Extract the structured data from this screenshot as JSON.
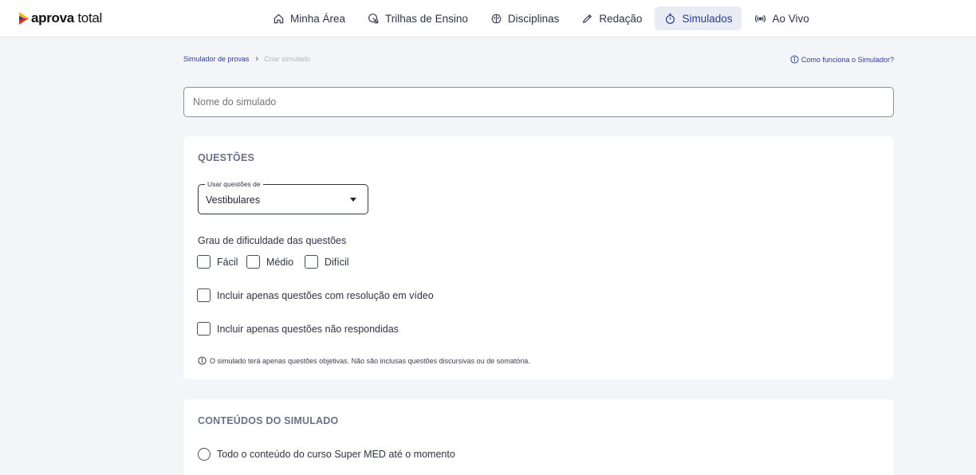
{
  "brand": {
    "name_bold": "aprova",
    "name_regular": " total"
  },
  "nav": {
    "items": [
      {
        "label": "Minha Área",
        "icon": "home-icon"
      },
      {
        "label": "Trilhas de Ensino",
        "icon": "trail-icon"
      },
      {
        "label": "Disciplinas",
        "icon": "brain-icon"
      },
      {
        "label": "Redação",
        "icon": "pencil-icon"
      },
      {
        "label": "Simulados",
        "icon": "stopwatch-icon",
        "active": true
      },
      {
        "label": "Ao Vivo",
        "icon": "broadcast-icon"
      }
    ]
  },
  "breadcrumb": {
    "parent": "Simulador de provas",
    "current": "Criar simulado"
  },
  "help_link": "Como funciona o Simulador?",
  "name_input": {
    "placeholder": "Nome do simulado"
  },
  "questoes": {
    "title": "QUESTÕES",
    "source_select": {
      "legend": "Usar questões de",
      "value": "Vestibulares"
    },
    "difficulty_label": "Grau de dificuldade das questões",
    "difficulty_options": [
      "Fácil",
      "Médio",
      "Difícil"
    ],
    "video_only": "Incluir apenas questões com resolução em vídeo",
    "unanswered_only": "Incluir apenas questões não respondidas",
    "note": "O simulado terá apenas questões objetivas. Não são inclusas questões discursivas ou de somatória."
  },
  "conteudos": {
    "title": "CONTEÚDOS DO SIMULADO",
    "option_all": "Todo o conteúdo do curso Super MED até o momento"
  },
  "colors": {
    "accent": "#2c3e8c",
    "active_nav_bg": "#e9ecf5",
    "page_bg": "#f4f5f8"
  }
}
